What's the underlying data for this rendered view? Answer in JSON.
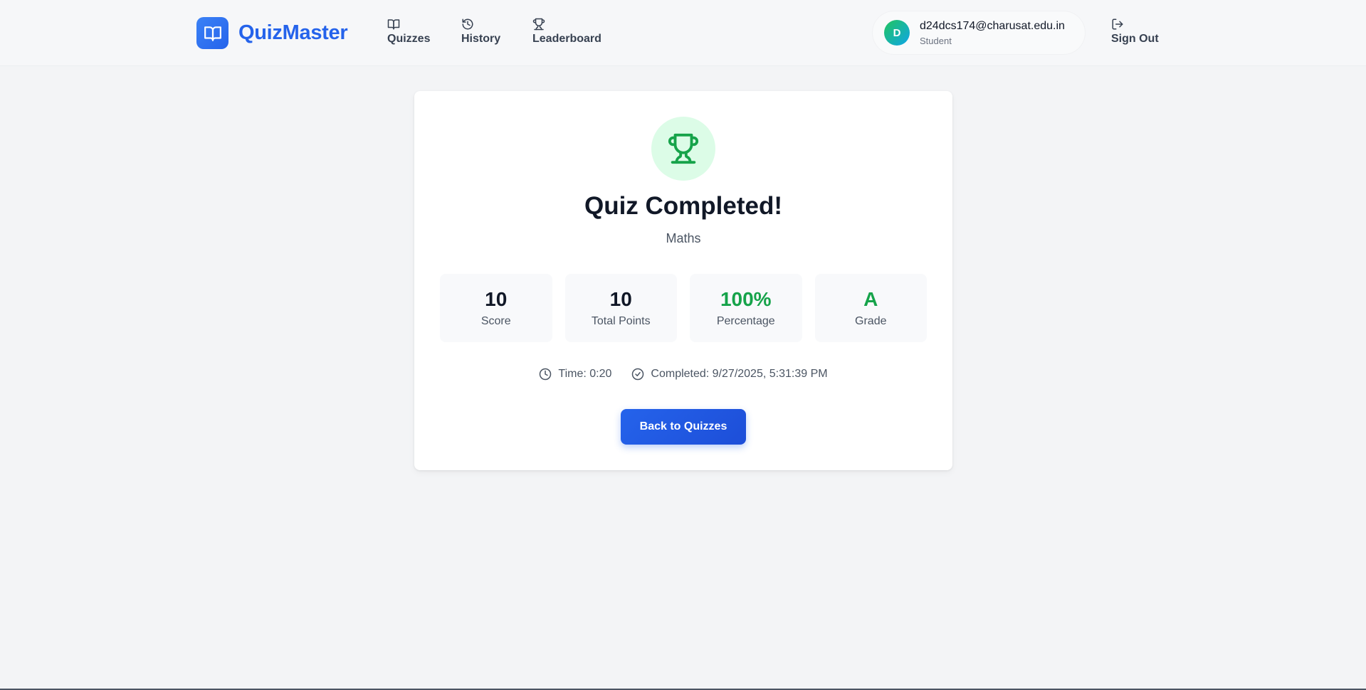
{
  "header": {
    "brand": "QuizMaster",
    "nav": [
      {
        "label": "Quizzes",
        "icon": "book-open-icon"
      },
      {
        "label": "History",
        "icon": "history-icon"
      },
      {
        "label": "Leaderboard",
        "icon": "trophy-icon"
      }
    ],
    "user": {
      "initial": "D",
      "email": "d24dcs174@charusat.edu.in",
      "role": "Student"
    },
    "sign_out": "Sign Out"
  },
  "result": {
    "title": "Quiz Completed!",
    "subject": "Maths",
    "stats": [
      {
        "value": "10",
        "label": "Score"
      },
      {
        "value": "10",
        "label": "Total Points"
      },
      {
        "value": "100%",
        "label": "Percentage"
      },
      {
        "value": "A",
        "label": "Grade"
      }
    ],
    "time": "Time: 0:20",
    "completed": "Completed: 9/27/2025, 5:31:39 PM",
    "back_button": "Back to Quizzes"
  },
  "colors": {
    "accent": "#2563eb",
    "success": "#16a34a",
    "success_bg": "#dcfce7",
    "background": "#f3f4f6"
  }
}
